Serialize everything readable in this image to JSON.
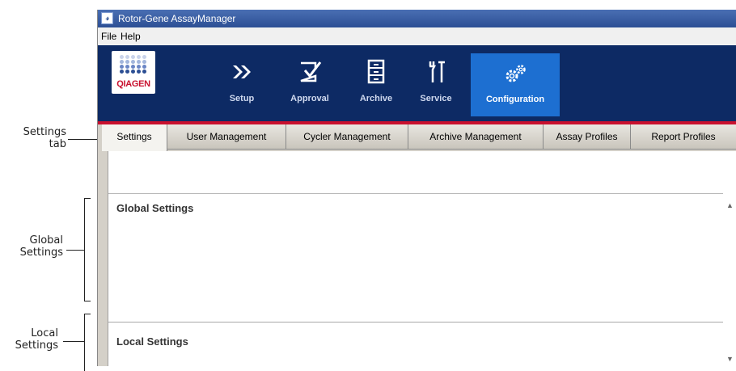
{
  "window": {
    "title": "Rotor-Gene AssayManager",
    "menu": [
      "File",
      "Help"
    ]
  },
  "logo": {
    "word": "QIAGEN"
  },
  "nav": {
    "items": [
      {
        "label": "Setup",
        "icon": "chevrons-right-icon"
      },
      {
        "label": "Approval",
        "icon": "checkbox-approval-icon"
      },
      {
        "label": "Archive",
        "icon": "archive-cabinet-icon"
      },
      {
        "label": "Service",
        "icon": "tools-icon"
      },
      {
        "label": "Configuration",
        "icon": "gears-icon",
        "active": true
      }
    ]
  },
  "tabs": [
    "Settings",
    "User Management",
    "Cycler Management",
    "Archive Management",
    "Assay Profiles",
    "Report Profiles"
  ],
  "panel": {
    "global_title": "Global Settings",
    "local_title": "Local Settings"
  },
  "callouts": {
    "settings_tab": [
      "Settings",
      "tab"
    ],
    "global": [
      "Global",
      "Settings"
    ],
    "local": [
      "Local",
      "Settings"
    ]
  },
  "colors": {
    "banner": "#0d2a64",
    "active_nav": "#1d6fd1",
    "accent_red": "#c8102e",
    "titlebar": "#2c4f94"
  }
}
